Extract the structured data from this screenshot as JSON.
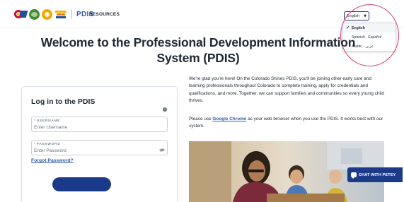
{
  "header": {
    "brand": "PDIS",
    "nav_resources": "RESOURCES",
    "logos": [
      "colorado-state-logo",
      "cdec-logo",
      "sun-logo",
      "colorado-shines-logo"
    ]
  },
  "language": {
    "current": "English",
    "options": [
      {
        "label": "English",
        "selected": true
      },
      {
        "label": "Spanish - Español",
        "selected": false
      },
      {
        "label": "Arabic - عربي",
        "selected": false
      }
    ]
  },
  "page_title": "Welcome to the Professional Development Information System (PDIS)",
  "login": {
    "title": "Log in to the PDIS",
    "info_icon": "i",
    "username_label": "USERNAME",
    "username_placeholder": "Enter Username",
    "password_label": "PASSWORD",
    "password_placeholder": "Enter Password",
    "forgot_link": "Forgot Password?"
  },
  "intro": {
    "paragraph": "We're glad you're here! On the Colorado Shines PDIS, you'll be joining other early care and learning professionals throughout Colorado to complete training, apply for credentials and qualifications, and more. Together, we can support families and communities so every young child thrives.",
    "browser_prefix": "Please use ",
    "browser_link": "Google Chrome",
    "browser_suffix": " as your web browser when you use the PDIS. It works best with our system."
  },
  "chat": {
    "label": "CHAT WITH PETEY"
  },
  "colors": {
    "primary_navy": "#1b3a8a",
    "link_blue": "#2f5fb0",
    "brand_blue": "#2b5ba8",
    "focus_ring_pink": "#d93b76",
    "required_red": "#d62828"
  }
}
